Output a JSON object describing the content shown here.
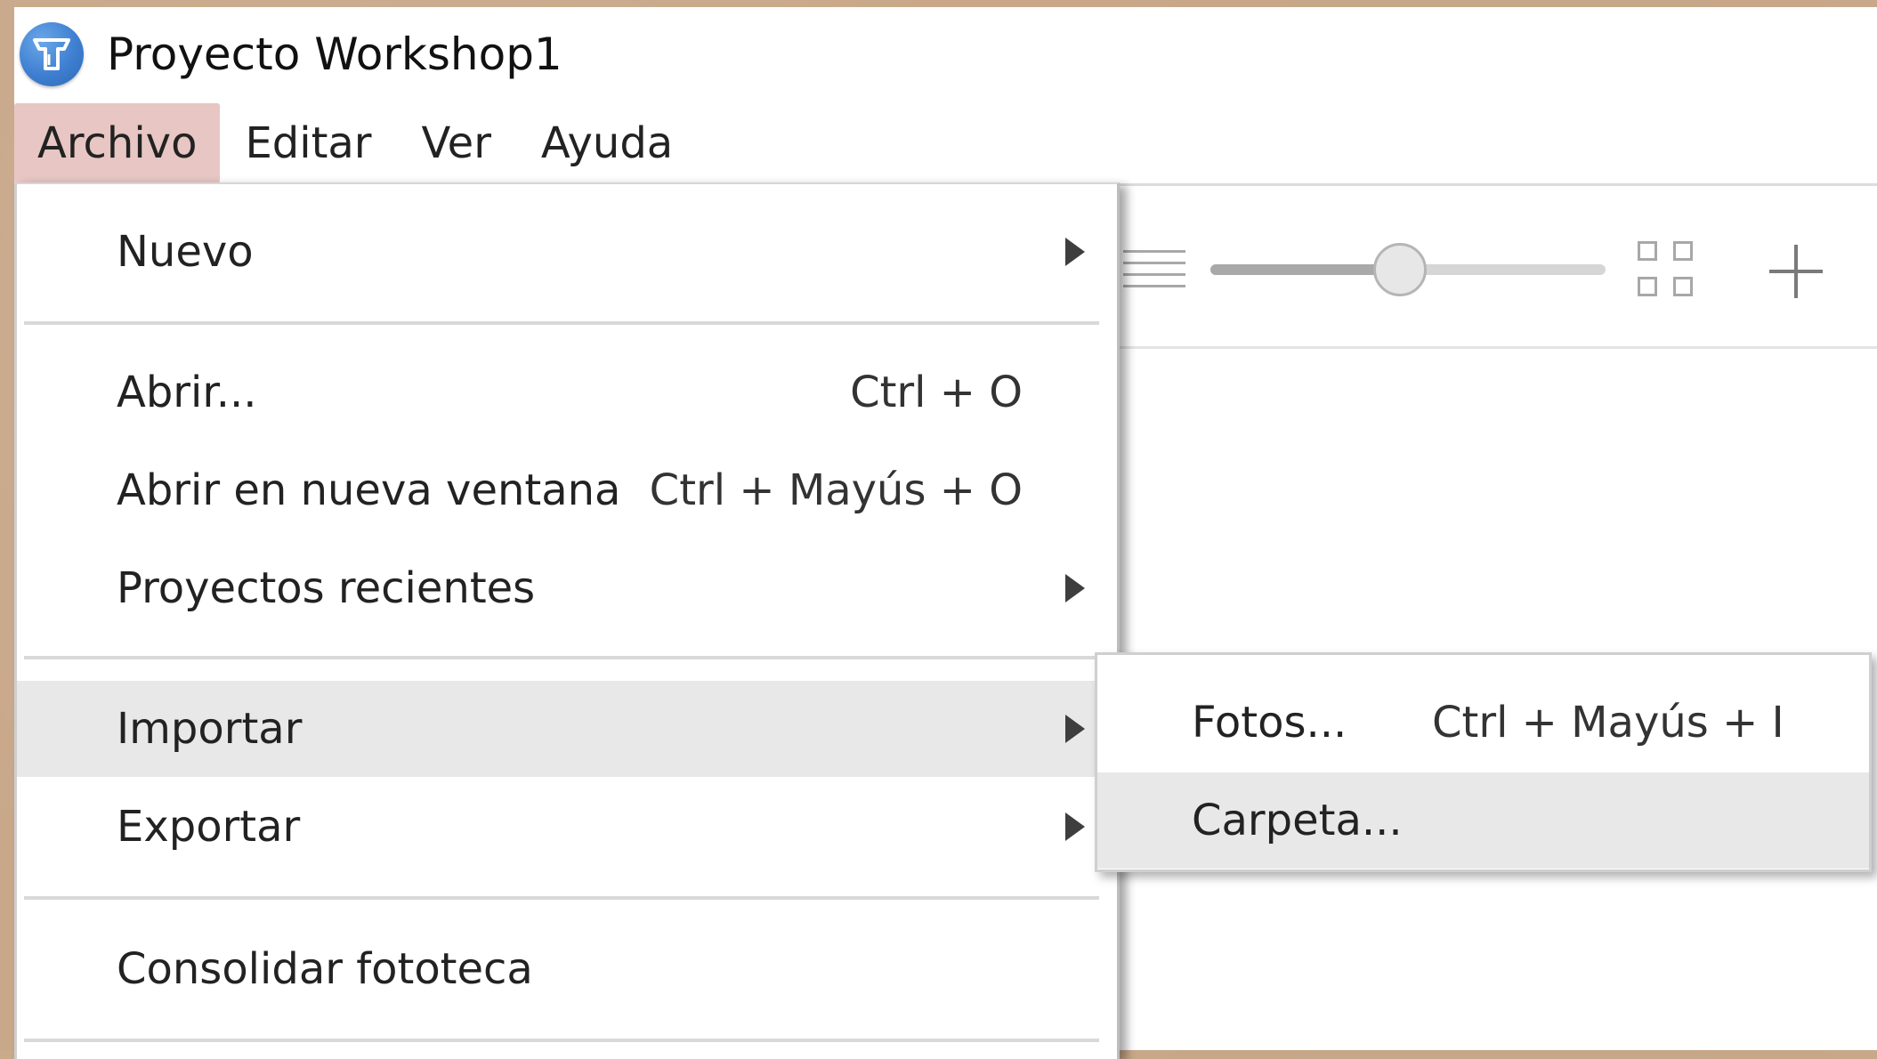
{
  "window": {
    "title": "Proyecto Workshop1",
    "app_icon": "workshop-app-icon"
  },
  "menubar": {
    "items": [
      {
        "id": "archivo",
        "label": "Archivo",
        "active": true
      },
      {
        "id": "editar",
        "label": "Editar",
        "active": false
      },
      {
        "id": "ver",
        "label": "Ver",
        "active": false
      },
      {
        "id": "ayuda",
        "label": "Ayuda",
        "active": false
      }
    ]
  },
  "toolbar": {
    "list_view_icon": "list-view-icon",
    "grid_view_icon": "grid-view-icon",
    "add_icon": "plus-icon",
    "zoom_fraction": 0.48
  },
  "file_menu": {
    "new": {
      "label": "Nuevo",
      "has_submenu": true
    },
    "open": {
      "label": "Abrir...",
      "shortcut": "Ctrl + O"
    },
    "open_new_window": {
      "label": "Abrir en nueva ventana",
      "shortcut": "Ctrl + Mayús + O"
    },
    "recent_projects": {
      "label": "Proyectos recientes",
      "has_submenu": true
    },
    "import": {
      "label": "Importar",
      "has_submenu": true,
      "highlighted": true
    },
    "export": {
      "label": "Exportar",
      "has_submenu": true
    },
    "consolidate": {
      "label": "Consolidar fototeca"
    }
  },
  "import_submenu": {
    "photos": {
      "label": "Fotos...",
      "shortcut": "Ctrl + Mayús + I"
    },
    "folder": {
      "label": "Carpeta...",
      "highlighted": true
    }
  },
  "colors": {
    "menu_active_bg": "#e7c6c3",
    "highlight_bg": "#e8e8e8",
    "app_icon_blue": "#3f7fd1"
  }
}
